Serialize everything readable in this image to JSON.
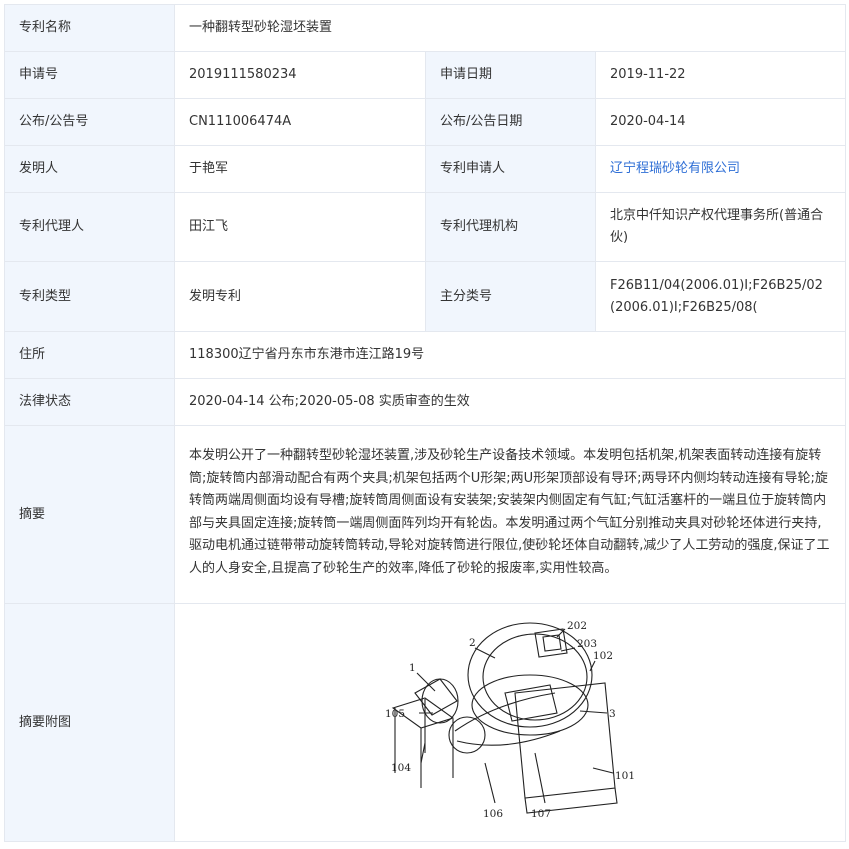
{
  "labels": {
    "name": "专利名称",
    "app_no": "申请号",
    "app_date": "申请日期",
    "pub_no": "公布/公告号",
    "pub_date": "公布/公告日期",
    "inventor": "发明人",
    "applicant": "专利申请人",
    "agent": "专利代理人",
    "agency": "专利代理机构",
    "type": "专利类型",
    "main_class": "主分类号",
    "address": "住所",
    "legal_status": "法律状态",
    "abstract": "摘要",
    "abstract_figure": "摘要附图"
  },
  "values": {
    "name": "一种翻转型砂轮湿坯装置",
    "app_no": "2019111580234",
    "app_date": "2019-11-22",
    "pub_no": "CN111006474A",
    "pub_date": "2020-04-14",
    "inventor": "于艳军",
    "applicant": "辽宁程瑞砂轮有限公司",
    "agent": "田江飞",
    "agency": "北京中仟知识产权代理事务所(普通合伙)",
    "type": "发明专利",
    "main_class": "F26B11/04(2006.01)I;F26B25/02(2006.01)I;F26B25/08(",
    "address": "118300辽宁省丹东市东港市连江路19号",
    "legal_status": "2020-04-14 公布;2020-05-08 实质审查的生效",
    "abstract": "本发明公开了一种翻转型砂轮湿坯装置,涉及砂轮生产设备技术领域。本发明包括机架,机架表面转动连接有旋转筒;旋转筒内部滑动配合有两个夹具;机架包括两个U形架;两U形架顶部设有导环;两导环内侧均转动连接有导轮;旋转筒两端周侧面均设有导槽;旋转筒周侧面设有安装架;安装架内侧固定有气缸;气缸活塞杆的一端且位于旋转筒内部与夹具固定连接;旋转筒一端周侧面阵列均开有轮齿。本发明通过两个气缸分别推动夹具对砂轮坯体进行夹持,驱动电机通过链带带动旋转筒转动,导轮对旋转筒进行限位,使砂轮坯体自动翻转,减少了人工劳动的强度,保证了工人的人身安全,且提高了砂轮生产的效率,降低了砂轮的报废率,实用性较高。"
  },
  "figure_callouts": [
    "1",
    "2",
    "202",
    "203",
    "102",
    "3",
    "105",
    "104",
    "101",
    "106",
    "107"
  ],
  "colors": {
    "label_bg": "#f1f6fd",
    "border": "#e4e8ef",
    "link": "#2f6fd6"
  }
}
